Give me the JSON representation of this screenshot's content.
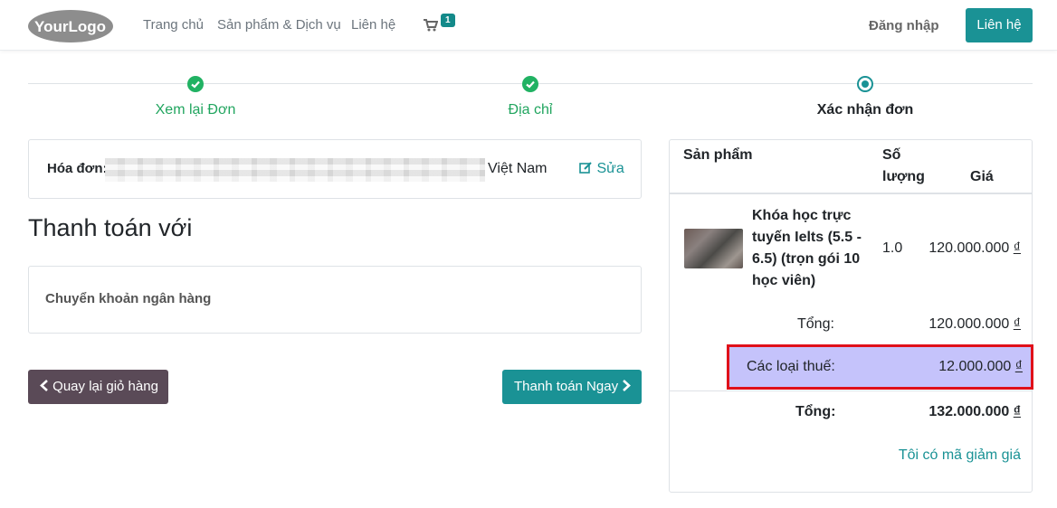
{
  "header": {
    "logo_text": "YourLogo",
    "nav": [
      "Trang chủ",
      "Sản phẩm & Dịch vụ",
      "Liên hệ"
    ],
    "cart_count": "1",
    "login": "Đăng nhập",
    "contact_button": "Liên hệ"
  },
  "steps": [
    {
      "label": "Xem lại Đơn",
      "state": "done"
    },
    {
      "label": "Địa chỉ",
      "state": "done"
    },
    {
      "label": "Xác nhận đơn",
      "state": "current"
    }
  ],
  "invoice": {
    "label": "Hóa đơn:",
    "country": "Việt Nam",
    "edit": "Sửa"
  },
  "payment": {
    "title": "Thanh toán với",
    "method": "Chuyển khoản ngân hàng",
    "back_button": "Quay lại giỏ hàng",
    "pay_button": "Thanh toán Ngay"
  },
  "summary": {
    "col_product": "Sản phẩm",
    "col_qty": "Số lượng",
    "col_price": "Giá",
    "product_name": "Khóa học trực tuyến Ielts (5.5 - 6.5) (trọn gói 10 học viên)",
    "product_qty": "1.0",
    "product_price": "120.000.000",
    "subtotal_label": "Tổng:",
    "subtotal_value": "120.000.000",
    "tax_label": "Các loại thuế:",
    "tax_value": "12.000.000",
    "total_label": "Tổng:",
    "total_value": "132.000.000",
    "currency": "₫",
    "promo_link": "Tôi có mã giảm giá"
  },
  "colors": {
    "primary": "#1a9295",
    "done_green": "#21b263",
    "back_button": "#5a4a57",
    "highlight": "#c5c3fb",
    "highlight_border": "#e0101a"
  }
}
